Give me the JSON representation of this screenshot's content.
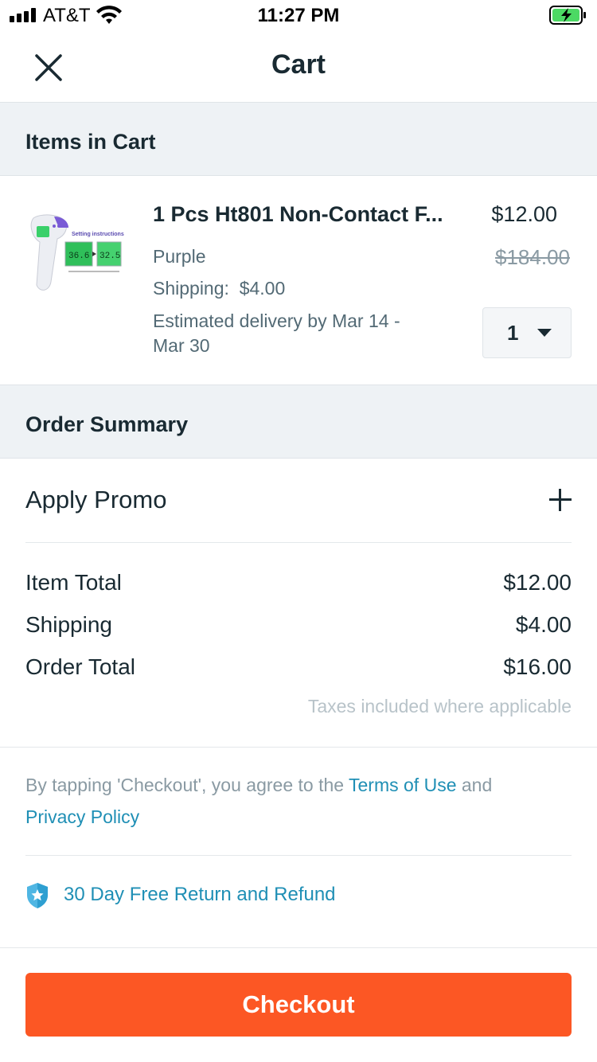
{
  "status_bar": {
    "carrier": "AT&T",
    "time": "11:27 PM"
  },
  "nav": {
    "title": "Cart",
    "close_icon": "close-icon"
  },
  "cart_section": {
    "header": "Items in Cart",
    "item": {
      "title": "1 Pcs Ht801 Non-Contact F...",
      "variant": "Purple",
      "shipping_label": "Shipping:",
      "shipping_value": "$4.00",
      "delivery_line1": "Estimated delivery by Mar 14 -",
      "delivery_line2": "Mar 30",
      "price": "$12.00",
      "original_price": "$184.00",
      "quantity": "1",
      "image_text": {
        "caption": "Setting instructions",
        "reading_left": "36.6",
        "reading_right": "32.5"
      }
    }
  },
  "order_summary": {
    "header": "Order Summary",
    "promo_label": "Apply Promo",
    "rows": [
      {
        "label": "Item Total",
        "value": "$12.00"
      },
      {
        "label": "Shipping",
        "value": "$4.00"
      },
      {
        "label": "Order Total",
        "value": "$16.00"
      }
    ],
    "taxes_note": "Taxes included where applicable"
  },
  "terms": {
    "prefix": "By tapping 'Checkout', you agree to the ",
    "terms_link": "Terms of Use",
    "middle": " and",
    "privacy_link": "Privacy Policy"
  },
  "guarantee": {
    "text": "30 Day Free Return and Refund",
    "icon": "shield-star-icon"
  },
  "checkout_button": "Checkout",
  "colors": {
    "accent": "#fc5724",
    "link": "#1f8fb5",
    "section_bg": "#eef2f5",
    "text_dark": "#192a32"
  }
}
